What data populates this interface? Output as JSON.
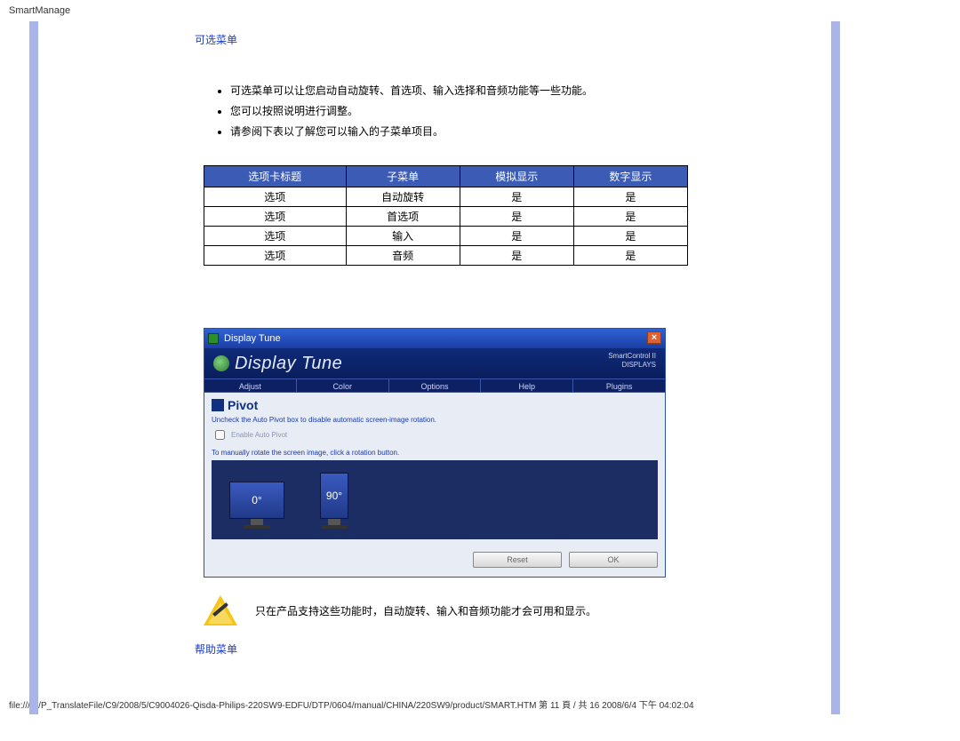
{
  "page_header": "SmartManage",
  "section1_title": "可选菜单",
  "bullets": [
    "可选菜单可以让您启动自动旋转、首选项、输入选择和音频功能等一些功能。",
    "您可以按照说明进行调整。",
    "请参阅下表以了解您可以输入的子菜单项目。"
  ],
  "table": {
    "headers": [
      "选项卡标题",
      "子菜单",
      "模拟显示",
      "数字显示"
    ],
    "rows": [
      [
        "选项",
        "自动旋转",
        "是",
        "是"
      ],
      [
        "选项",
        "首选项",
        "是",
        "是"
      ],
      [
        "选项",
        "输入",
        "是",
        "是"
      ],
      [
        "选项",
        "音频",
        "是",
        "是"
      ]
    ]
  },
  "app_window": {
    "titlebar": "Display Tune",
    "banner_title": "Display Tune",
    "brand_line1": "SmartControl II",
    "brand_line2": "DISPLAYS",
    "tabs": [
      "Adjust",
      "Color",
      "Options",
      "Help",
      "Plugins"
    ],
    "pivot_label": "Pivot",
    "hint1": "Uncheck the Auto Pivot box to disable automatic screen-image rotation.",
    "checkbox_label": "Enable Auto Pivot",
    "hint2": "To manually rotate the screen image, click a rotation button.",
    "rot0": "0°",
    "rot90": "90°",
    "btn_reset": "Reset",
    "btn_ok": "OK"
  },
  "note_text": "只在产品支持这些功能时，自动旋转、输入和音频功能才会可用和显示。",
  "section2_title": "帮助菜单",
  "footer": "file:///P|/P_TranslateFile/C9/2008/5/C9004026-Qisda-Philips-220SW9-EDFU/DTP/0604/manual/CHINA/220SW9/product/SMART.HTM 第 11 頁 / 共 16 2008/6/4 下午 04:02:04"
}
